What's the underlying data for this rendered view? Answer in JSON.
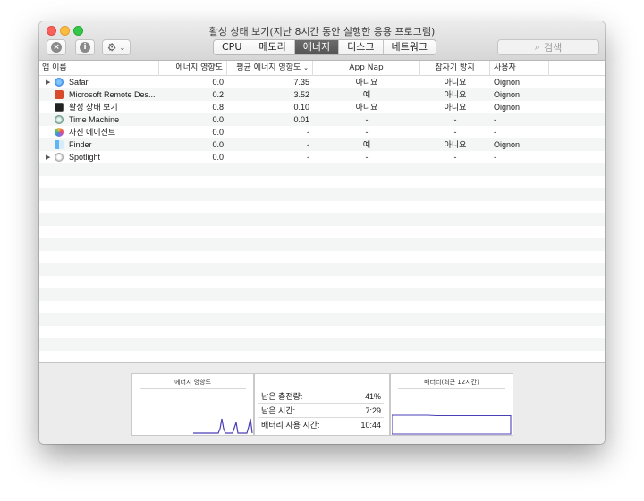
{
  "window": {
    "title": "활성 상태 보기(지난 8시간 동안 실행한 응용 프로그램)"
  },
  "toolbar": {
    "stop_icon": "x-circle-icon",
    "info_icon": "info-icon",
    "gear_icon": "gear-icon",
    "tabs": [
      {
        "label": "CPU",
        "active": false
      },
      {
        "label": "메모리",
        "active": false
      },
      {
        "label": "에너지",
        "active": true
      },
      {
        "label": "디스크",
        "active": false
      },
      {
        "label": "네트워크",
        "active": false
      }
    ],
    "search_placeholder": "검색"
  },
  "table": {
    "columns": [
      "앱 이름",
      "에너지 영향도",
      "평균 에너지 영향도",
      "App Nap",
      "잠자기 방지",
      "사용자"
    ],
    "rows": [
      {
        "name": "Safari",
        "icon": "compass-icon",
        "expandable": true,
        "energy": "0.0",
        "avg": "7.35",
        "appnap": "아니요",
        "sleep": "아니요",
        "user": "Oignon"
      },
      {
        "name": "Microsoft Remote Des...",
        "icon": "remote-desktop-icon",
        "expandable": false,
        "energy": "0.2",
        "avg": "3.52",
        "appnap": "예",
        "sleep": "아니요",
        "user": "Oignon"
      },
      {
        "name": "활성 상태 보기",
        "icon": "activity-monitor-icon",
        "expandable": false,
        "energy": "0.8",
        "avg": "0.10",
        "appnap": "아니요",
        "sleep": "아니요",
        "user": "Oignon"
      },
      {
        "name": "Time Machine",
        "icon": "time-machine-icon",
        "expandable": false,
        "energy": "0.0",
        "avg": "0.01",
        "appnap": "-",
        "sleep": "-",
        "user": "-"
      },
      {
        "name": "사진 에이전트",
        "icon": "photos-icon",
        "expandable": false,
        "energy": "0.0",
        "avg": "-",
        "appnap": "-",
        "sleep": "-",
        "user": "-"
      },
      {
        "name": "Finder",
        "icon": "finder-icon",
        "expandable": false,
        "energy": "0.0",
        "avg": "-",
        "appnap": "예",
        "sleep": "아니요",
        "user": "Oignon"
      },
      {
        "name": "Spotlight",
        "icon": "spotlight-icon",
        "expandable": true,
        "energy": "0.0",
        "avg": "-",
        "appnap": "-",
        "sleep": "-",
        "user": "-"
      }
    ]
  },
  "bottom": {
    "energy_title": "에너지 영향도",
    "stats": [
      {
        "label": "남은 충전량:",
        "value": "41%"
      },
      {
        "label": "남은 시간:",
        "value": "7:29"
      },
      {
        "label": "배터리 사용 시간:",
        "value": "10:44"
      }
    ],
    "battery_title": "배터리(최근 12시간)",
    "graph_color": "#4a3fb5"
  }
}
